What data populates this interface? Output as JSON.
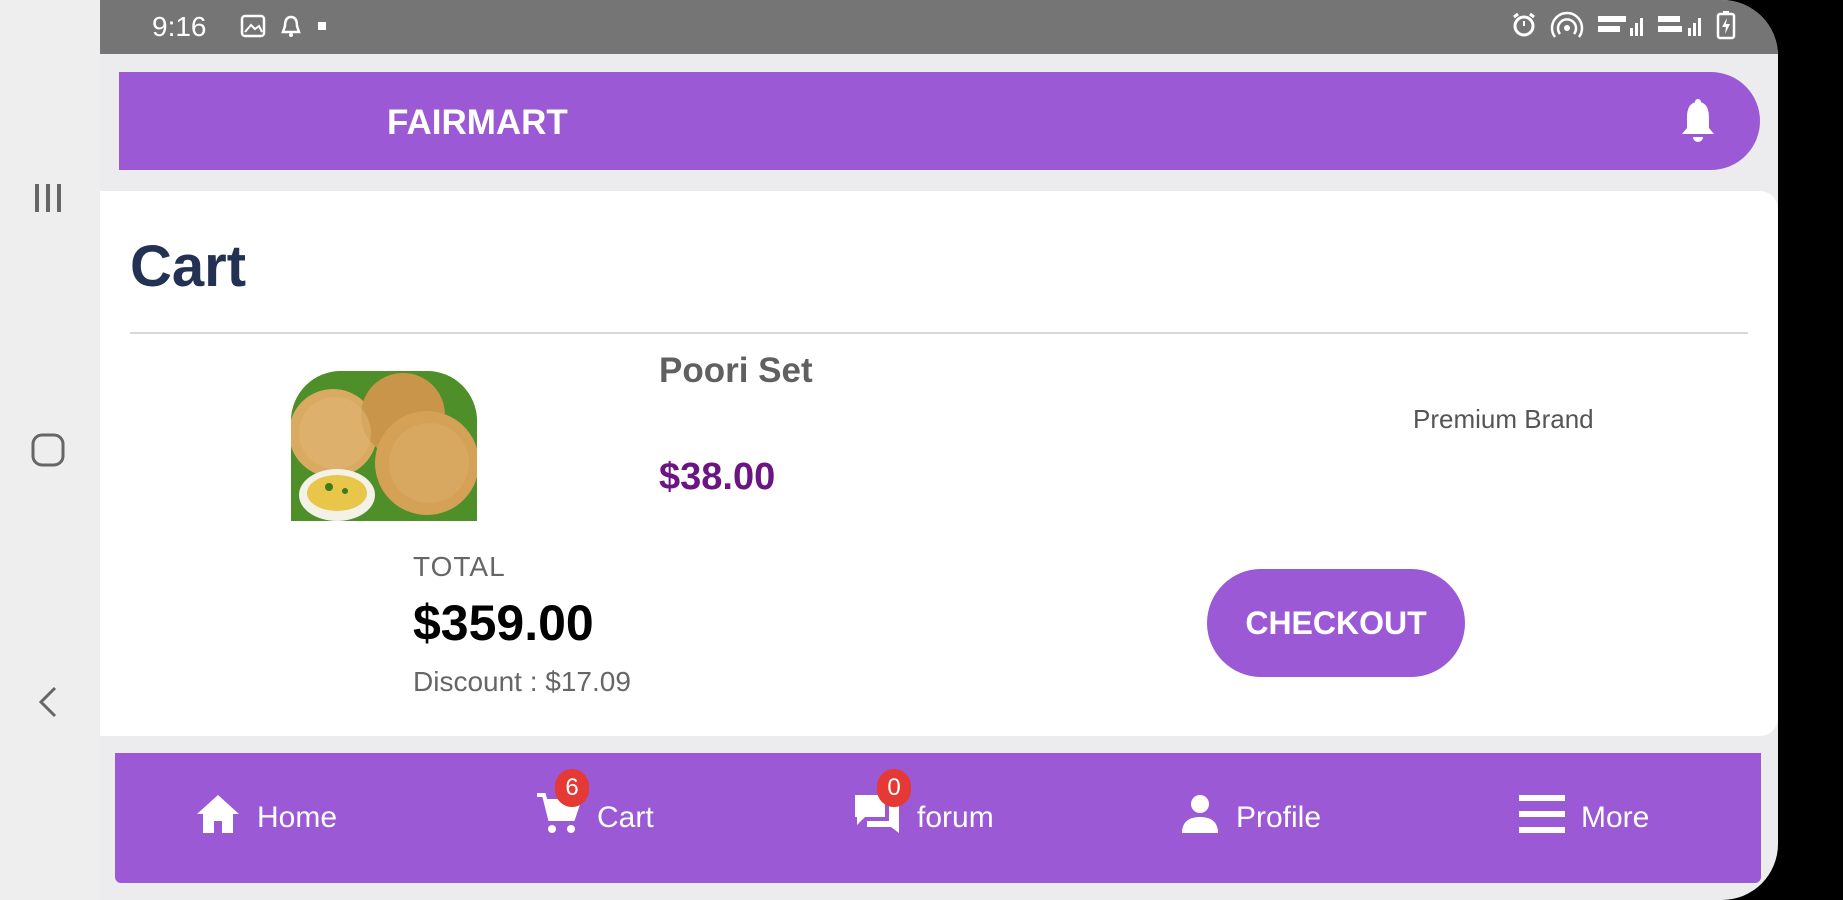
{
  "status_bar": {
    "time": "9:16"
  },
  "app_bar": {
    "title": "FAIRMART"
  },
  "page": {
    "title": "Cart"
  },
  "cart_item": {
    "name": "Poori Set",
    "price": "$38.00",
    "brand": "Premium Brand"
  },
  "summary": {
    "total_label": "TOTAL",
    "total_value": "$359.00",
    "discount": "Discount : $17.09"
  },
  "checkout_label": "CHECKOUT",
  "bottom_nav": {
    "home": {
      "label": "Home"
    },
    "cart": {
      "label": "Cart",
      "badge": "6"
    },
    "forum": {
      "label": "forum",
      "badge": "0"
    },
    "profile": {
      "label": "Profile"
    },
    "more": {
      "label": "More"
    }
  },
  "colors": {
    "accent": "#9b59d5",
    "price": "#6b1582",
    "title": "#233152",
    "badge": "#e53935"
  }
}
